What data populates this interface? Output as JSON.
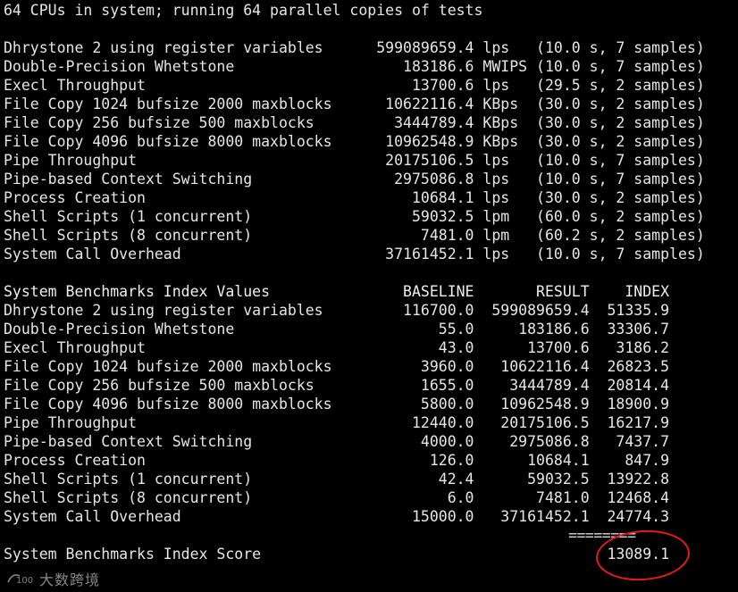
{
  "terminal": {
    "lines": [
      "64 CPUs in system; running 64 parallel copies of tests",
      "",
      "Dhrystone 2 using register variables      599089659.4 lps   (10.0 s, 7 samples)",
      "Double-Precision Whetstone                   183186.6 MWIPS (10.0 s, 7 samples)",
      "Execl Throughput                              13700.6 lps   (29.5 s, 2 samples)",
      "File Copy 1024 bufsize 2000 maxblocks      10622116.4 KBps  (30.0 s, 2 samples)",
      "File Copy 256 bufsize 500 maxblocks         3444789.4 KBps  (30.0 s, 2 samples)",
      "File Copy 4096 bufsize 8000 maxblocks      10962548.9 KBps  (30.0 s, 2 samples)",
      "Pipe Throughput                            20175106.5 lps   (10.0 s, 7 samples)",
      "Pipe-based Context Switching                2975086.8 lps   (10.0 s, 7 samples)",
      "Process Creation                              10684.1 lps   (30.0 s, 2 samples)",
      "Shell Scripts (1 concurrent)                  59032.5 lpm   (60.0 s, 2 samples)",
      "Shell Scripts (8 concurrent)                   7481.0 lpm   (60.2 s, 2 samples)",
      "System Call Overhead                       37161452.1 lps   (10.0 s, 7 samples)",
      "",
      "System Benchmarks Index Values               BASELINE       RESULT    INDEX",
      "Dhrystone 2 using register variables         116700.0  599089659.4  51335.9",
      "Double-Precision Whetstone                       55.0     183186.6  33306.7",
      "Execl Throughput                                 43.0      13700.6   3186.2",
      "File Copy 1024 bufsize 2000 maxblocks          3960.0   10622116.4  26823.5",
      "File Copy 256 bufsize 500 maxblocks            1655.0    3444789.4  20814.4",
      "File Copy 4096 bufsize 8000 maxblocks          5800.0   10962548.9  18900.9",
      "Pipe Throughput                               12440.0   20175106.5  16217.9",
      "Pipe-based Context Switching                   4000.0    2975086.8   7437.7",
      "Process Creation                                126.0      10684.1    847.9",
      "Shell Scripts (1 concurrent)                     42.4      59032.5  13922.8",
      "Shell Scripts (8 concurrent)                      6.0       7481.0  12468.4",
      "System Call Overhead                          15000.0   37161452.1  24774.3",
      "                                                                   ========",
      "System Benchmarks Index Score                                       13089.1"
    ]
  },
  "annotation": {
    "circle_color": "#e11c1c"
  },
  "watermark": {
    "logo_text": "100",
    "label": "大数跨境"
  }
}
